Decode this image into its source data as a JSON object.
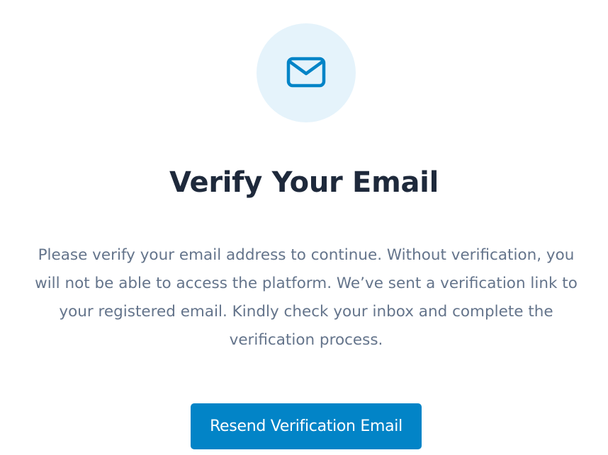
{
  "verify": {
    "icon": "envelope-icon",
    "title": "Verify Your Email",
    "message": "Please verify your email address to continue. Without verification, you will not be able to access the platform. We’ve sent a verification link to your registered email. Kindly check your inbox and complete the verification process.",
    "resend_button_label": "Resend Verification Email"
  },
  "colors": {
    "icon_background": "#e5f3fb",
    "accent": "#0284c7",
    "title": "#1e293b",
    "message": "#64748b",
    "button_text": "#ffffff"
  }
}
